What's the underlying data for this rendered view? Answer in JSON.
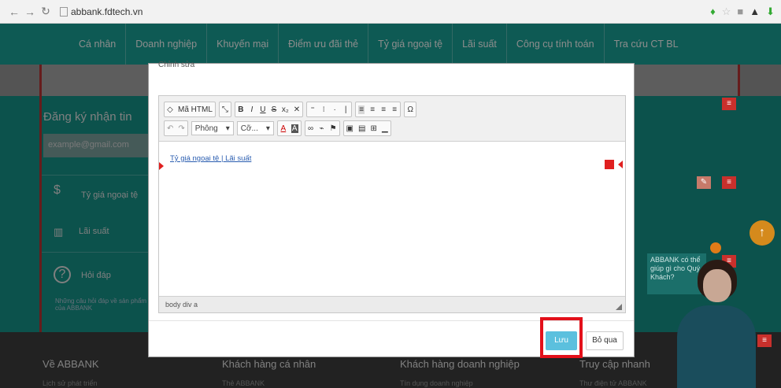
{
  "browser": {
    "url": "abbank.fdtech.vn"
  },
  "nav": {
    "items": [
      "Cá nhân",
      "Doanh nghiệp",
      "Khuyến mại",
      "Điểm ưu đãi thẻ",
      "Tỷ giá ngoại tệ",
      "Lãi suất",
      "Công cụ tính toán",
      "Tra cứu CT BL"
    ]
  },
  "background": {
    "newsletter_title": "Đăng ký nhận tin",
    "email_placeholder": "example@gmail.com",
    "exchange_rate": "Tỷ giá ngoại tệ",
    "interest_rate": "Lãi suất",
    "faq": "Hỏi đáp",
    "faq_desc": "Những câu hỏi đáp về sản phẩm của ABBANK",
    "chat_text": "ABBANK có thể giúp gì cho Quý Khách?",
    "footer": {
      "col1": "Về ABBANK",
      "col1_item": "Lịch sử phát triển",
      "col2": "Khách hàng cá nhân",
      "col2_item": "Thẻ ABBANK",
      "col3": "Khách hàng doanh nghiệp",
      "col3_item": "Tín dụng doanh nghiệp",
      "col4": "Truy cập nhanh",
      "col4_item": "Thư điện tử ABBANK"
    }
  },
  "modal": {
    "title_stub": "Chỉnh sửa",
    "toolbar": {
      "source_label": "Mã HTML",
      "format_select": "Phông",
      "size_select": "Cỡ...",
      "bold": "B",
      "italic": "I",
      "underline": "U",
      "strike": "S",
      "subscript": "x₂",
      "clear": "✕",
      "omega": "Ω"
    },
    "content_link": "Tỷ giá ngoại tệ | Lãi suất",
    "status_path": "body  div  a",
    "save_label": "Lưu",
    "skip_label": "Bỏ qua"
  },
  "colors": {
    "nav_bg": "#1aa59a",
    "highlight": "#e3101a",
    "save_btn": "#5bc0de"
  }
}
